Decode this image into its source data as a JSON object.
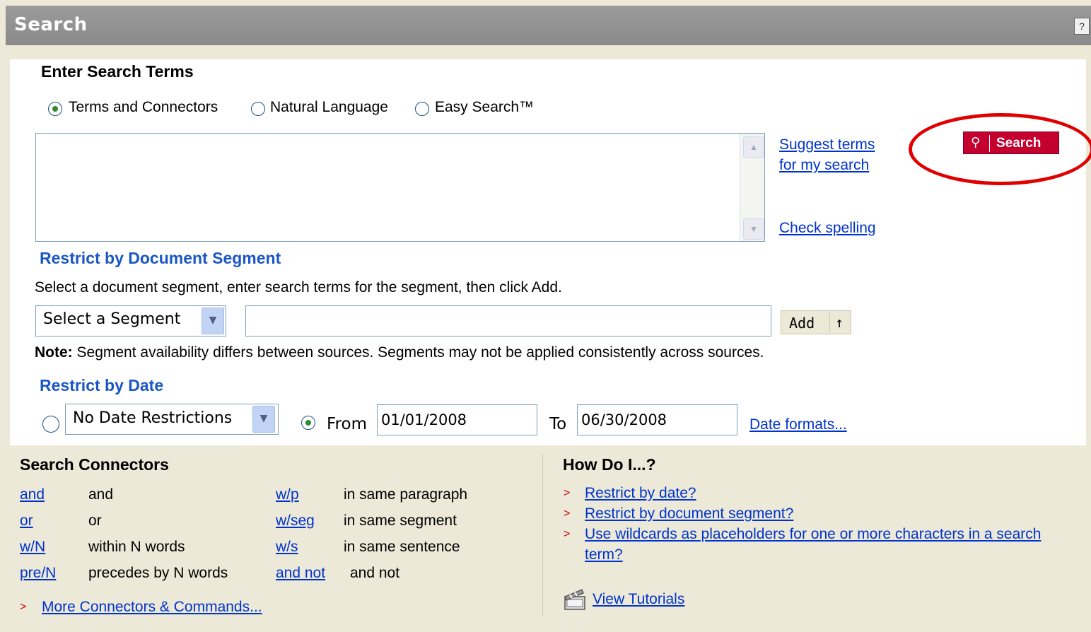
{
  "header": {
    "title": "Search",
    "help_label": "?"
  },
  "enter_terms": {
    "title": "Enter Search Terms",
    "modes": [
      {
        "label": "Terms and Connectors",
        "selected": true
      },
      {
        "label": "Natural Language",
        "selected": false
      },
      {
        "label": "Easy Search™",
        "selected": false
      }
    ],
    "query_value": "",
    "suggest_link_line1": "Suggest terms",
    "suggest_link_line2": "for my search",
    "check_spelling_link": "Check spelling",
    "search_button_label": "Search",
    "search_button_color": "#c4002f"
  },
  "segment": {
    "title": "Restrict by Document Segment",
    "instructions": "Select a document segment, enter search terms for the segment, then click Add.",
    "select_value": "Select a Segment",
    "terms_value": "",
    "add_button_label": "Add",
    "add_button_icon": "↑",
    "note_label": "Note:",
    "note_text": " Segment availability differs between sources. Segments may not be applied consistently across sources."
  },
  "date": {
    "title": "Restrict by Date",
    "preset_selected": false,
    "preset_value": "No Date Restrictions",
    "range_selected": true,
    "from_label": "From",
    "from_value": "01/01/2008",
    "to_label": "To",
    "to_value": "06/30/2008",
    "formats_link": "Date formats..."
  },
  "connectors": {
    "title": "Search Connectors",
    "left": [
      {
        "link": "and",
        "desc": "and"
      },
      {
        "link": "or",
        "desc": "or"
      },
      {
        "link": "w/N",
        "desc": "within N words"
      },
      {
        "link": "pre/N",
        "desc": "precedes by N words"
      }
    ],
    "right": [
      {
        "link": "w/p",
        "desc": "in same paragraph"
      },
      {
        "link": "w/seg",
        "desc": "in same segment"
      },
      {
        "link": "w/s",
        "desc": "in same sentence"
      },
      {
        "link": "and not",
        "desc": "and not"
      }
    ],
    "more_link": "More Connectors & Commands...",
    "bullet": ">"
  },
  "how_do_i": {
    "title": "How Do I...?",
    "bullet": ">",
    "items": [
      "Restrict by date?",
      "Restrict by document segment?",
      "Use wildcards as placeholders for one or more characters in a search",
      "term?"
    ],
    "tutorials_link": "View Tutorials"
  },
  "colors": {
    "link": "#0033cc",
    "section_blue": "#1a56c4",
    "highlight_circle": "#e00000",
    "background": "#ece9d8"
  }
}
